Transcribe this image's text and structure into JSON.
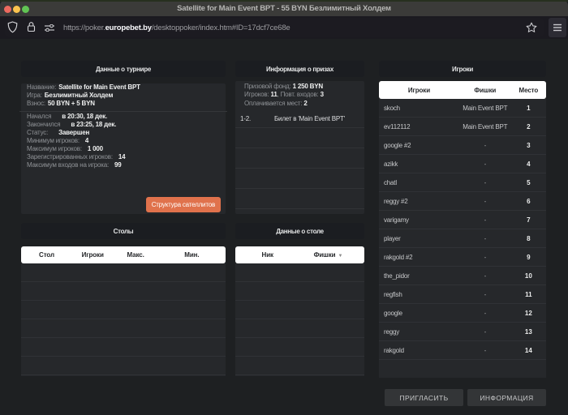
{
  "window": {
    "title": "Satellite for Main Event BPT - 55 BYN Безлимитный Холдем",
    "url_prefix": "https://poker.",
    "url_domain": "europebet.by",
    "url_path": "/desktoppoker/index.htm#ID=17dcf7ce68e"
  },
  "tournament": {
    "title": "Данные о турнире",
    "fields_top": [
      {
        "label": "Название:",
        "value": "Satellite for Main Event BPT"
      },
      {
        "label": "Игра:",
        "value": "Безлимитный Холдем"
      },
      {
        "label": "Взнос:",
        "value": "50 BYN + 5 BYN"
      }
    ],
    "fields_bottom": [
      {
        "label": "Начался",
        "value": "в 20:30, 18 дек.",
        "gap": true
      },
      {
        "label": "Закончился",
        "value": "в 23:25, 18 дек.",
        "gap": true
      },
      {
        "label": "Статус:",
        "value": "Завершен",
        "gap": true
      },
      {
        "label": "Минимум игроков:",
        "value": "4"
      },
      {
        "label": "Максимум игроков:",
        "value": "1 000"
      },
      {
        "label": "Зарегистрированных игроков:",
        "value": "14"
      },
      {
        "label": "Максимум входов на игрока:",
        "value": "99"
      }
    ],
    "button": "Структура сателлитов"
  },
  "prizes": {
    "title": "Информация о призах",
    "lines": [
      [
        {
          "t": "Призовой фонд:",
          "b": false
        },
        {
          "t": " 1 250 BYN",
          "b": true
        }
      ],
      [
        {
          "t": "Игроков: ",
          "b": false
        },
        {
          "t": "11",
          "b": true
        },
        {
          "t": ", Повт. входов: ",
          "b": false
        },
        {
          "t": "3",
          "b": true
        }
      ],
      [
        {
          "t": "Оплачивается мест:  ",
          "b": false
        },
        {
          "t": "2",
          "b": true
        }
      ]
    ],
    "rows": [
      {
        "place": "1-2.",
        "prize": "Билет в 'Main Event BPT'"
      }
    ],
    "empty_rows": 4
  },
  "players": {
    "title": "Игроки",
    "columns": [
      "Игроки",
      "Фишки",
      "Место"
    ],
    "rows": [
      {
        "name": "skoch",
        "chips": "Main Event BPT",
        "place": "1"
      },
      {
        "name": "ev112112",
        "chips": "Main Event BPT",
        "place": "2"
      },
      {
        "name": "google #2",
        "chips": "-",
        "place": "3"
      },
      {
        "name": "azikk",
        "chips": "-",
        "place": "4"
      },
      {
        "name": "chatl",
        "chips": "-",
        "place": "5"
      },
      {
        "name": "reggy #2",
        "chips": "-",
        "place": "6"
      },
      {
        "name": "varigamy",
        "chips": "-",
        "place": "7"
      },
      {
        "name": "player",
        "chips": "-",
        "place": "8"
      },
      {
        "name": "rakgold #2",
        "chips": "-",
        "place": "9"
      },
      {
        "name": "the_pidor",
        "chips": "-",
        "place": "10"
      },
      {
        "name": "regfish",
        "chips": "-",
        "place": "11"
      },
      {
        "name": "google",
        "chips": "-",
        "place": "12"
      },
      {
        "name": "reggy",
        "chips": "-",
        "place": "13"
      },
      {
        "name": "rakgold",
        "chips": "-",
        "place": "14"
      }
    ]
  },
  "tables_panel": {
    "title": "Столы",
    "columns": [
      "Стол",
      "Игроки",
      "Макс.",
      "Мин."
    ],
    "empty_rows": 6
  },
  "table_data_panel": {
    "title": "Данные о столе",
    "columns": [
      "Ник",
      "Фишки"
    ],
    "empty_rows": 6
  },
  "buttons": {
    "invite": "ПРИГЛАСИТЬ",
    "info": "ИНФОРМАЦИЯ"
  }
}
